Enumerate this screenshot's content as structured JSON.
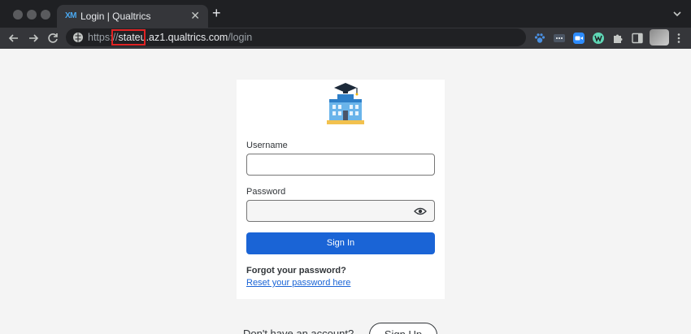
{
  "browser": {
    "tab": {
      "logo_text": "XM",
      "title": "Login | Qualtrics",
      "close_glyph": "✕"
    },
    "new_tab_glyph": "+",
    "url": {
      "scheme": "https://",
      "host": "stateu.az1.qualtrics.com",
      "path": "/login"
    },
    "highlight_color": "#e02424",
    "extensions": [
      "paw-extension-icon",
      "dashlane-icon",
      "zoom-icon",
      "w-extension-icon",
      "puzzle-icon",
      "sidebar-icon",
      "profile-avatar",
      "kebab-menu-icon"
    ]
  },
  "login": {
    "logo_icon": "university-building-icon",
    "username_label": "Username",
    "username_value": "",
    "password_label": "Password",
    "password_value": "",
    "sign_in_label": "Sign In",
    "forgot_label": "Forgot your password?",
    "reset_link": "Reset your password here",
    "no_account_label": "Don't have an account?",
    "sign_up_label": "Sign Up"
  },
  "colors": {
    "primary": "#1a64d6",
    "page_bg": "#f4f4f4",
    "chrome_dark": "#35363a"
  }
}
